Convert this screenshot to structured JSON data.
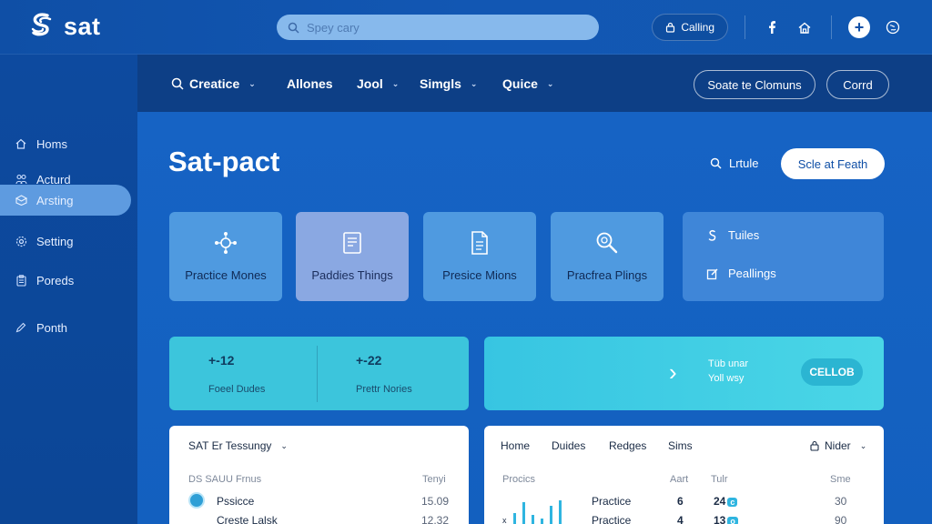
{
  "brand": {
    "name": "sat"
  },
  "search": {
    "placeholder": "Spey cary"
  },
  "top_actions": {
    "calling_label": "Calling"
  },
  "sidebar": {
    "items": [
      {
        "label": "Homs",
        "icon": "home-icon"
      },
      {
        "label": "Acturd",
        "icon": "people-icon"
      },
      {
        "label": "Arsting",
        "icon": "box-icon",
        "active": true
      },
      {
        "label": "Setting",
        "icon": "gear-icon"
      },
      {
        "label": "Poreds",
        "icon": "clipboard-icon"
      },
      {
        "label": "Ponth",
        "icon": "pencil-icon"
      }
    ]
  },
  "subnav": {
    "items": [
      {
        "label": "Creatice",
        "has_search_icon": true,
        "has_chevron": true
      },
      {
        "label": "Allones",
        "has_chevron": false
      },
      {
        "label": "Jool",
        "has_chevron": true
      },
      {
        "label": "Simgls",
        "has_chevron": true
      },
      {
        "label": "Quice",
        "has_chevron": true
      }
    ],
    "button_primary": "Soate te Clomuns",
    "button_secondary": "Corrd"
  },
  "page": {
    "title": "Sat-pact",
    "search_label": "Lrtule",
    "action_label": "Scle at Feath"
  },
  "tiles": [
    {
      "label": "Practice Mones",
      "icon": "network-icon"
    },
    {
      "label": "Paddies Things",
      "icon": "notebook-icon",
      "highlight": true
    },
    {
      "label": "Presice Mions",
      "icon": "document-icon"
    },
    {
      "label": "Pracfrea Plings",
      "icon": "magnifier-icon"
    }
  ],
  "side_card": {
    "items": [
      {
        "label": "Tuiles",
        "icon": "link-icon"
      },
      {
        "label": "Peallings",
        "icon": "edit-square-icon"
      }
    ]
  },
  "stats": [
    {
      "value": "+-12",
      "label": "Foeel Dudes"
    },
    {
      "value": "+-22",
      "label": "Prettr Nories"
    }
  ],
  "banner": {
    "line1": "Tüb unar",
    "line2": "Yoll wsy",
    "button": "CELLOB"
  },
  "left_panel": {
    "title": "SAT Er Tessungy",
    "col_left": "DS SAUU Frnus",
    "col_right": "Tenyi",
    "rows": [
      {
        "label": "Pssicce",
        "value": "15.09"
      },
      {
        "label": "Creste Lalsk",
        "value": "12.32"
      }
    ]
  },
  "right_panel": {
    "tabs": [
      "Home",
      "Duides",
      "Redges",
      "Sims"
    ],
    "filter_label": "Nider",
    "columns": [
      "Procics",
      "Aart",
      "Tulr",
      "Sme"
    ],
    "rows": [
      {
        "label": "Practice",
        "aart": "6",
        "tulr": "24",
        "badge": "c",
        "sme": "30"
      },
      {
        "label": "Practice",
        "aart": "4",
        "tulr": "13",
        "badge": "o",
        "sme": "90"
      }
    ]
  },
  "colors": {
    "topbar": "#1257b3",
    "sidebar": "#0d4a9f",
    "main": "#1663c4",
    "accent_cyan": "#3cc5dc",
    "tile_blue": "#4f9ae0",
    "tile_violet": "#8aa8e2"
  }
}
